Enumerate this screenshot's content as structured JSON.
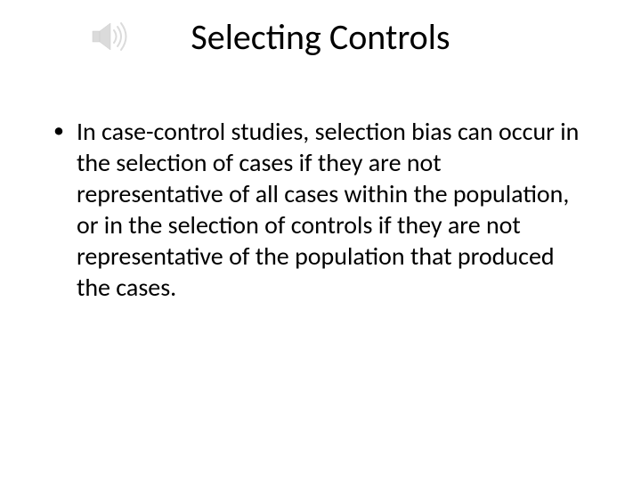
{
  "slide": {
    "title": "Selecting Controls",
    "bullets": [
      "In case-control studies, selection bias can occur in the selection of cases if they are not representative of all cases within the population, or in the selection of controls if they are not representative of the population that produced the cases."
    ]
  }
}
